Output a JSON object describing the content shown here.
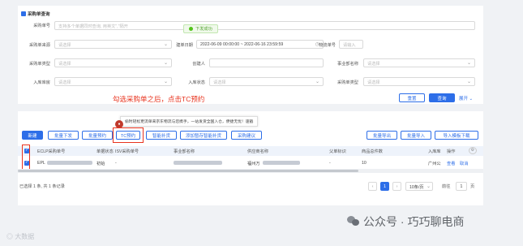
{
  "section_title": "采购单查询",
  "filters": {
    "po_no_label": "采购单号",
    "po_no_placeholder": "支持多个单据同时查询, 用英文\",\"隔开",
    "source_label": "采购单来源",
    "source_placeholder": "请选择",
    "type_label": "采购单类型",
    "type_placeholder": "请选择",
    "created_label": "建单日期",
    "created_value": "2022-06-09 00:00:00 ~ 2022-06-16 23:59:59",
    "logistics_label": "物流单号",
    "logistics_placeholder": "请输入",
    "status_label": "采购单状态",
    "status_placeholder": "请选择",
    "creator_label": "创建人",
    "dept_label": "事业部名称",
    "dept_placeholder": "请选择",
    "warehouse_label": "入库库房",
    "warehouse_placeholder": "请选择",
    "instock_label": "入库状态",
    "instock_placeholder": "请选择",
    "subtype_label": "采购单类型",
    "subtype_placeholder": "请选择"
  },
  "toast": "下发成功",
  "actions": {
    "reset": "重置",
    "search": "查询",
    "expand": "展开"
  },
  "hint": "勾选采购单之后，点击TC预约",
  "tooltip": "偷时轻松更流单来京东物流与您携手，一站发货全国入仓，便捷无忧！速戳",
  "toolbar": {
    "new": "新建",
    "batch_issue": "批量下发",
    "batch_reserve": "批量预约",
    "tc_reserve": "TC预约",
    "smart_replenish": "智能补货",
    "add_to_smart": "添加暂存智能补货",
    "advice": "采购建议",
    "batch_export": "批量导出",
    "batch_import": "批量导入",
    "import_template": "导入模板下载"
  },
  "table": {
    "headers": [
      "ECLP采购单号",
      "单据状态",
      "ISV采购单号",
      "事业部名称",
      "供应商名称",
      "父单标识",
      "商品总件数",
      "入库库",
      "操作"
    ],
    "row": {
      "po_prefix": "EPL",
      "status": "初始",
      "isv": "-",
      "supplier": "福州万",
      "parent": "-",
      "qty": "10",
      "warehouse": "广州公",
      "op_view": "查看",
      "op_cancel": "取消"
    }
  },
  "pager": {
    "selected": "已选择 1 条, 共 1 条记录",
    "page": "1",
    "page_size": "10条/页",
    "goto_label": "前往",
    "goto_value": "1",
    "page_unit": "页"
  },
  "watermark": "大数据",
  "wechat": "公众号 · 巧巧聊电商",
  "colors": {
    "primary": "#2d6ee8",
    "hint_red": "#e8331e",
    "success": "#52c41a"
  }
}
